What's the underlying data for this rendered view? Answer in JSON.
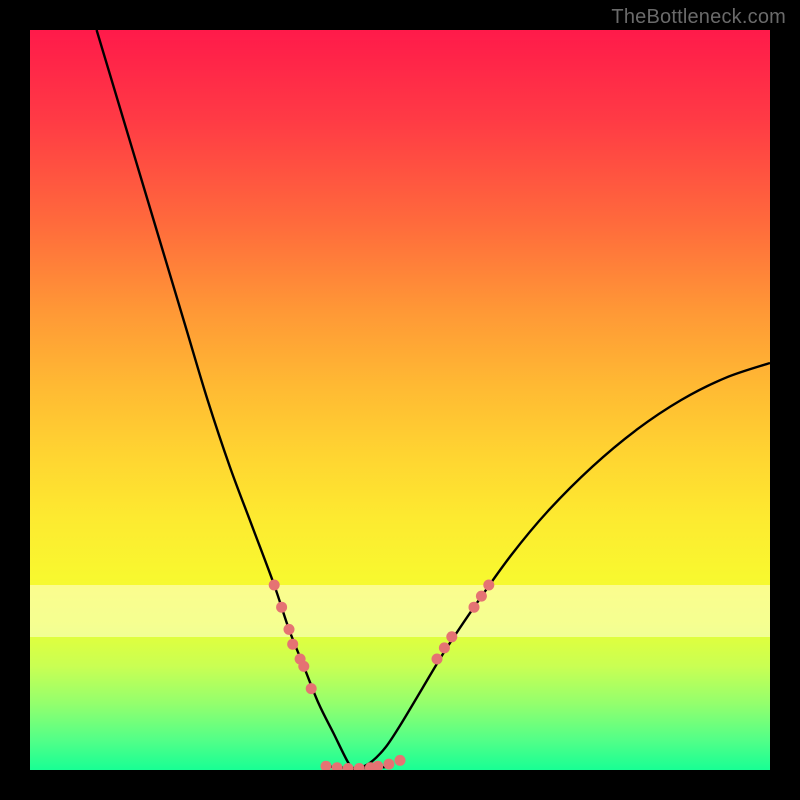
{
  "watermark": "TheBottleneck.com",
  "colors": {
    "frame": "#000000",
    "curve": "#000000",
    "dots": "#e57373",
    "gradient_top": "#ff1a4a",
    "gradient_bottom": "#18ff94",
    "pale_band": "rgba(255,255,220,0.55)"
  },
  "chart_data": {
    "type": "line",
    "title": "",
    "xlabel": "",
    "ylabel": "",
    "xlim": [
      0,
      100
    ],
    "ylim": [
      0,
      100
    ],
    "note": "V-shaped bottleneck curve. y≈100 is top (red), y≈0 is bottom (green). Minimum of curve is near x≈44 at y≈0. Right branch asymptotes near y≈55 at x=100. Left branch goes off top edge around x≈9.",
    "series": [
      {
        "name": "left-branch",
        "x": [
          9,
          12,
          15,
          18,
          21,
          24,
          27,
          30,
          33,
          35,
          37,
          39,
          41,
          43,
          44
        ],
        "y": [
          100,
          90,
          80,
          70,
          60,
          50,
          41,
          33,
          25,
          19,
          14,
          9,
          5,
          1,
          0
        ]
      },
      {
        "name": "right-branch",
        "x": [
          44,
          46,
          48,
          50,
          53,
          56,
          60,
          65,
          70,
          76,
          82,
          88,
          94,
          100
        ],
        "y": [
          0,
          1,
          3,
          6,
          11,
          16,
          22,
          29,
          35,
          41,
          46,
          50,
          53,
          55
        ]
      }
    ],
    "floor_segment": {
      "x_start": 40,
      "x_end": 49,
      "y": 0
    },
    "dot_clusters": [
      {
        "name": "left-cluster",
        "points": [
          [
            33,
            25
          ],
          [
            34,
            22
          ],
          [
            35,
            19
          ],
          [
            35.5,
            17
          ],
          [
            36.5,
            15
          ],
          [
            37,
            14
          ],
          [
            38,
            11
          ]
        ]
      },
      {
        "name": "floor-cluster",
        "points": [
          [
            40,
            0.5
          ],
          [
            41.5,
            0.3
          ],
          [
            43,
            0.2
          ],
          [
            44.5,
            0.2
          ],
          [
            46,
            0.3
          ],
          [
            47,
            0.5
          ],
          [
            48.5,
            0.8
          ],
          [
            50,
            1.3
          ]
        ]
      },
      {
        "name": "right-cluster",
        "points": [
          [
            55,
            15
          ],
          [
            56,
            16.5
          ],
          [
            57,
            18
          ],
          [
            60,
            22
          ],
          [
            61,
            23.5
          ],
          [
            62,
            25
          ]
        ]
      }
    ],
    "pale_band_y_range": [
      18,
      25
    ]
  }
}
